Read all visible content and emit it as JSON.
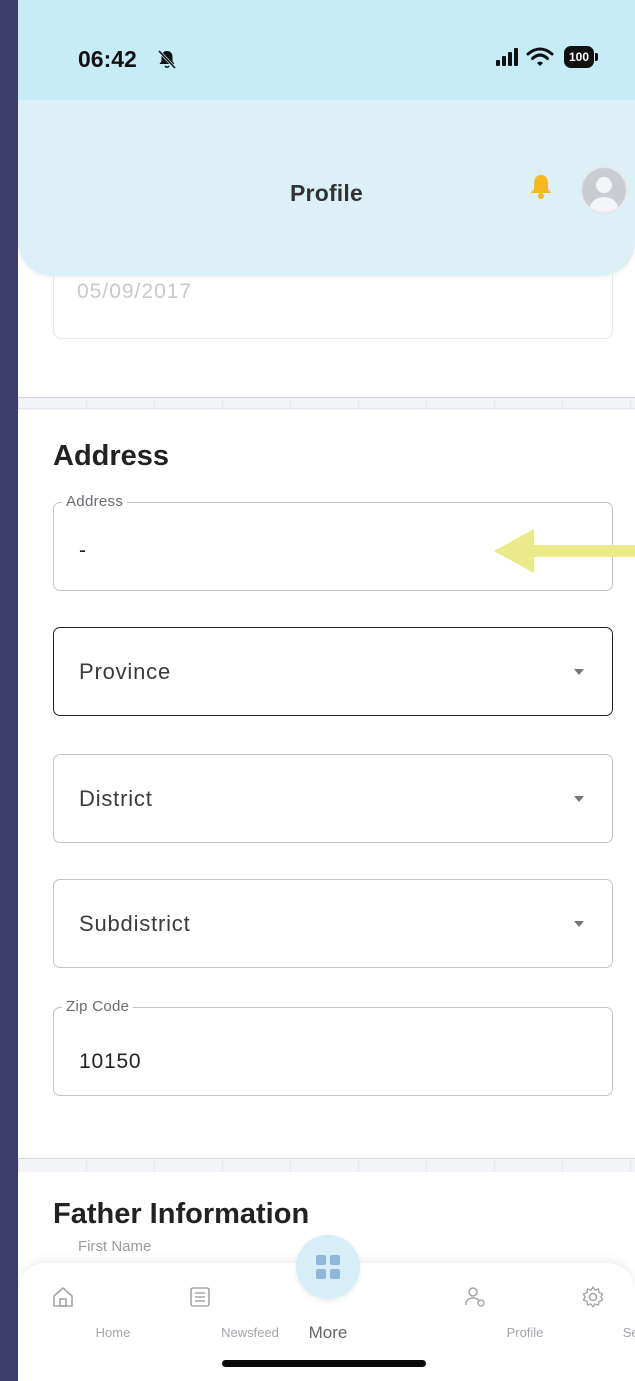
{
  "status_bar": {
    "time": "06:42",
    "battery": "100"
  },
  "header": {
    "title": "Profile"
  },
  "previous_field": {
    "value": "05/09/2017"
  },
  "address_section": {
    "title": "Address",
    "address": {
      "label": "Address",
      "value": "-"
    },
    "province": {
      "placeholder": "Province"
    },
    "district": {
      "placeholder": "District"
    },
    "subdistrict": {
      "placeholder": "Subdistrict"
    },
    "zip": {
      "label": "Zip Code",
      "value": "10150"
    }
  },
  "father_section": {
    "title": "Father Information",
    "first_name_label": "First Name"
  },
  "bottom_nav": {
    "items": [
      {
        "label": "Home",
        "icon": "home-icon"
      },
      {
        "label": "Newsfeed",
        "icon": "newspaper-icon"
      },
      {
        "label": "More",
        "icon": "grid-icon"
      },
      {
        "label": "Profile",
        "icon": "profile-icon"
      },
      {
        "label": "Setting",
        "icon": "gear-icon"
      }
    ]
  },
  "colors": {
    "header_bg": "#dcf0f8",
    "status_bg": "#c6ecf8",
    "bell": "#f5b820",
    "annotation_arrow": "#eaea8a",
    "frame": "#3d3d6b"
  }
}
